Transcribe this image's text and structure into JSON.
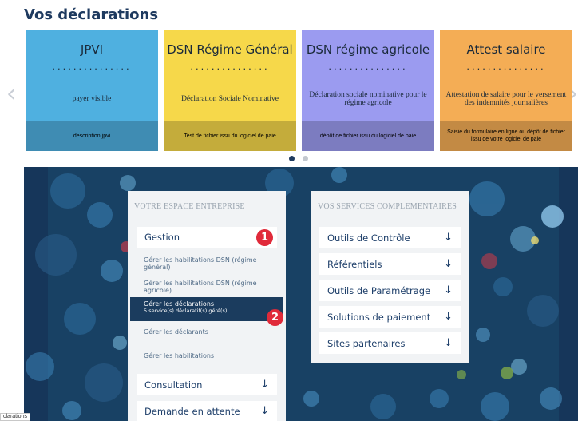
{
  "page": {
    "title": "Vos déclarations"
  },
  "carousel": {
    "prev_icon": "chevron-left-icon",
    "next_icon": "chevron-right-icon",
    "cards": [
      {
        "title": "JPVI",
        "dots": "...............",
        "description": "payer visible",
        "footer": "description jpvi",
        "color": "#4fb0e0",
        "footer_color": "#3f8cb3"
      },
      {
        "title": "DSN Régime Général",
        "dots": "...............",
        "description": "Déclaration Sociale Nominative",
        "footer": "Test de fichier issu du logiciel de paie",
        "color": "#f6d84a",
        "footer_color": "#c4ac3b"
      },
      {
        "title": "DSN régime agricole",
        "dots": "...............",
        "description": "Déclaration sociale nominative pour le régime agricole",
        "footer": "dépôt de fichier issu du logiciel de paie",
        "color": "#9b9bf0",
        "footer_color": "#7c7cc0"
      },
      {
        "title": "Attest salaire",
        "dots": "...............",
        "description": "Attestation de salaire pour le versement des indemnités journalières",
        "footer": "Saisie du formulaire en ligne ou dépôt de fichier issu de votre logiciel de paie",
        "color": "#f4ad55",
        "footer_color": "#c38a44"
      }
    ],
    "indicator_active_color": "#1e3a5f",
    "indicator_inactive_color": "#c3c8cf"
  },
  "espace_entreprise": {
    "heading": "VOTRE ESPACE ENTREPRISE",
    "gestion": {
      "label": "Gestion",
      "badge": "1"
    },
    "sub_items": [
      {
        "label": "Gérer les habilitations DSN (régime général)"
      },
      {
        "label": "Gérer les habilitations DSN (régime agricole)"
      },
      {
        "label": "Gérer les déclarations",
        "detail": "5 service(s) déclaratif(s) géré(s)",
        "badge": "2"
      },
      {
        "label": "Gérer les déclarants"
      },
      {
        "label": "Gérer les habilitations"
      }
    ],
    "consultation": {
      "label": "Consultation",
      "icon": "arrow-down-icon"
    },
    "demande": {
      "label": "Demande en attente",
      "icon": "arrow-down-icon"
    }
  },
  "services": {
    "heading": "VOS SERVICES COMPLEMENTAIRES",
    "items": [
      {
        "label": "Outils de Contrôle",
        "icon": "arrow-down-icon"
      },
      {
        "label": "Référentiels",
        "icon": "arrow-down-icon"
      },
      {
        "label": "Outils de Paramétrage",
        "icon": "arrow-down-icon"
      },
      {
        "label": "Solutions de paiement",
        "icon": "arrow-down-icon"
      },
      {
        "label": "Sites partenaires",
        "icon": "arrow-down-icon"
      }
    ]
  },
  "corner_tab": "clarations",
  "colors": {
    "accent": "#1e3a5f",
    "badge": "#e02a3a",
    "hero": "#16365a"
  }
}
